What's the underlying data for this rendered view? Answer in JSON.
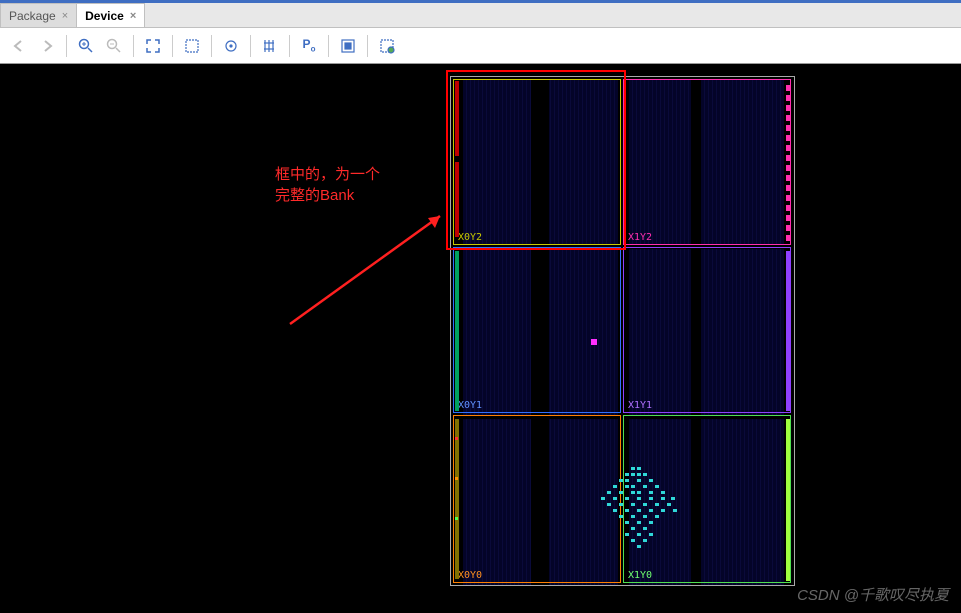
{
  "tabs": [
    {
      "label": "Package",
      "active": false
    },
    {
      "label": "Device",
      "active": true
    }
  ],
  "toolbar": {
    "back": "←",
    "fwd": "→",
    "zoomin": "+",
    "zoomout": "−",
    "fit": "⤢",
    "zoomarea": "⛶",
    "select": "◎",
    "route": "⊞",
    "place": "P₀",
    "highlight": "▣",
    "unhighlight": "▢"
  },
  "regions": {
    "x0y2": {
      "label": "X0Y2",
      "color": "#c8c800"
    },
    "x1y2": {
      "label": "X1Y2",
      "color": "#ff2fb0"
    },
    "x0y1": {
      "label": "X0Y1",
      "color": "#3070ff"
    },
    "x1y1": {
      "label": "X1Y1",
      "color": "#9040ff"
    },
    "x0y0": {
      "label": "X0Y0",
      "color": "#ff8000"
    },
    "x1y0": {
      "label": "X1Y0",
      "color": "#50e050"
    }
  },
  "annotation": {
    "line1": "框中的，为一个",
    "line2": "完整的Bank"
  },
  "watermark": "CSDN @千歌叹尽执夏"
}
